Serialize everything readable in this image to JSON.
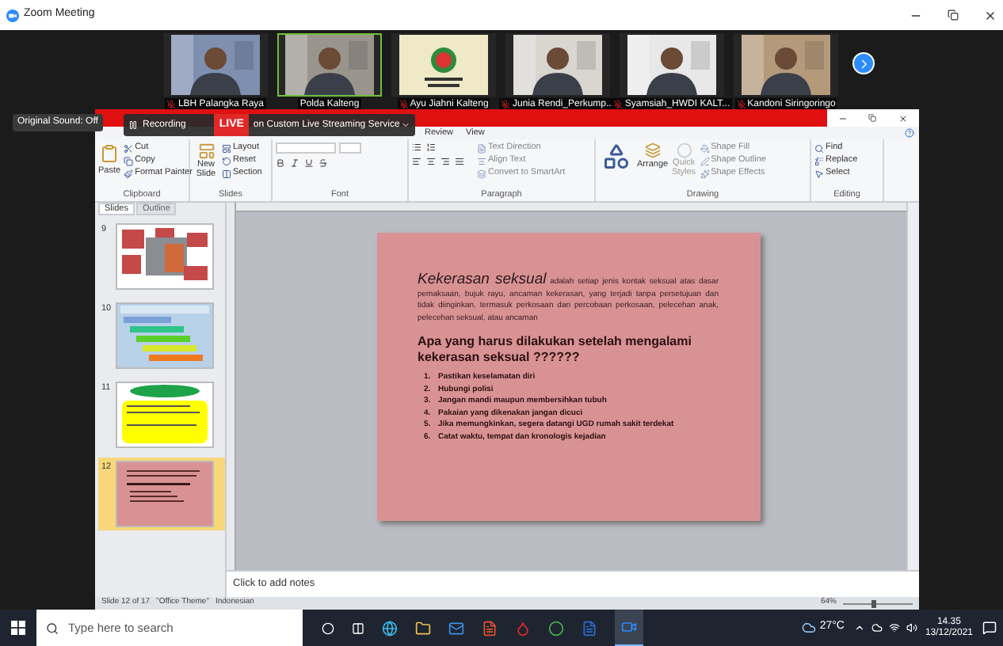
{
  "window": {
    "title": "Zoom Meeting"
  },
  "participants": [
    {
      "name": "LBH Palangka Raya",
      "muted": true,
      "speaking": false,
      "kind": "person"
    },
    {
      "name": "Polda Kalteng",
      "muted": false,
      "speaking": true,
      "kind": "person"
    },
    {
      "name": "Ayu Jiahni Kalteng",
      "muted": true,
      "speaking": false,
      "kind": "logo"
    },
    {
      "name": "Junia Rendi_Perkump...",
      "muted": true,
      "speaking": false,
      "kind": "person"
    },
    {
      "name": "Syamsiah_HWDI KALT...",
      "muted": true,
      "speaking": false,
      "kind": "person"
    },
    {
      "name": "Kandoni Siringoringo",
      "muted": true,
      "speaking": false,
      "kind": "person"
    }
  ],
  "share": {
    "original_sound": "Original Sound: Off",
    "recording": "Recording",
    "live": "LIVE",
    "live_service": "on Custom Live Streaming Service"
  },
  "ppt": {
    "tabs": [
      {
        "label": "Review",
        "selected": false
      },
      {
        "label": "View",
        "selected": false
      }
    ],
    "ribbon": {
      "clipboard": {
        "paste": "Paste",
        "cut": "Cut",
        "copy": "Copy",
        "format_painter": "Format Painter",
        "label": "Clipboard"
      },
      "slides": {
        "new_slide": "New Slide",
        "layout": "Layout",
        "reset": "Reset",
        "section": "Section",
        "label": "Slides"
      },
      "font": {
        "label": "Font"
      },
      "paragraph": {
        "text_direction": "Text Direction",
        "align_text": "Align Text",
        "smartart": "Convert to SmartArt",
        "label": "Paragraph"
      },
      "drawing": {
        "arrange": "Arrange",
        "quick_styles": "Quick Styles",
        "shape_fill": "Shape Fill",
        "shape_outline": "Shape Outline",
        "shape_effects": "Shape Effects",
        "label": "Drawing"
      },
      "editing": {
        "find": "Find",
        "replace": "Replace",
        "select": "Select",
        "label": "Editing"
      }
    },
    "pane_tabs": [
      {
        "label": "Slides",
        "selected": true
      },
      {
        "label": "Outline",
        "selected": false
      }
    ],
    "thumbnails": [
      {
        "number": "9",
        "selected": false
      },
      {
        "number": "10",
        "kind": "steps",
        "selected": false
      },
      {
        "number": "11",
        "kind": "yellow",
        "selected": false
      },
      {
        "number": "12",
        "kind": "pink",
        "selected": true
      }
    ],
    "slide": {
      "term": "Kekerasan seksual",
      "definition": "adalah setiap jenis kontak seksual atas dasar pemaksaan, bujuk rayu, ancaman kekerasan, yang terjadi tanpa persetujuan dan tidak diinginkan, termasuk perkosaan dan percobaan perkosaan, pelecehan anak, pelecehan seksual, atau ancaman",
      "heading": "Apa yang harus dilakukan setelah mengalami kekerasan seksual ??????",
      "steps": [
        {
          "number": "1.",
          "text": "Pastikan keselamatan diri"
        },
        {
          "number": "2.",
          "text": "Hubungi polisi"
        },
        {
          "number": "3.",
          "text": "Jangan mandi maupun membersihkan tubuh"
        },
        {
          "number": "4.",
          "text": "Pakaian yang dikenakan jangan dicuci"
        },
        {
          "number": "5.",
          "text": "Jika memungkinkan, segera datangi UGD rumah sakit terdekat"
        },
        {
          "number": "6.",
          "text": "Catat waktu, tempat dan kronologis kejadian"
        }
      ]
    },
    "notes_placeholder": "Click to add notes",
    "status_bar": {
      "slide": "Slide 12 of 17",
      "theme": "\"Office Theme\"",
      "language": "Indonesian",
      "zoom": "64%",
      "zoom_slider": {
        "level": 0.45
      }
    }
  },
  "taskbar": {
    "search_placeholder": "Type here to search",
    "weather": "27°C",
    "time": "14.35",
    "date": "13/12/2021"
  }
}
